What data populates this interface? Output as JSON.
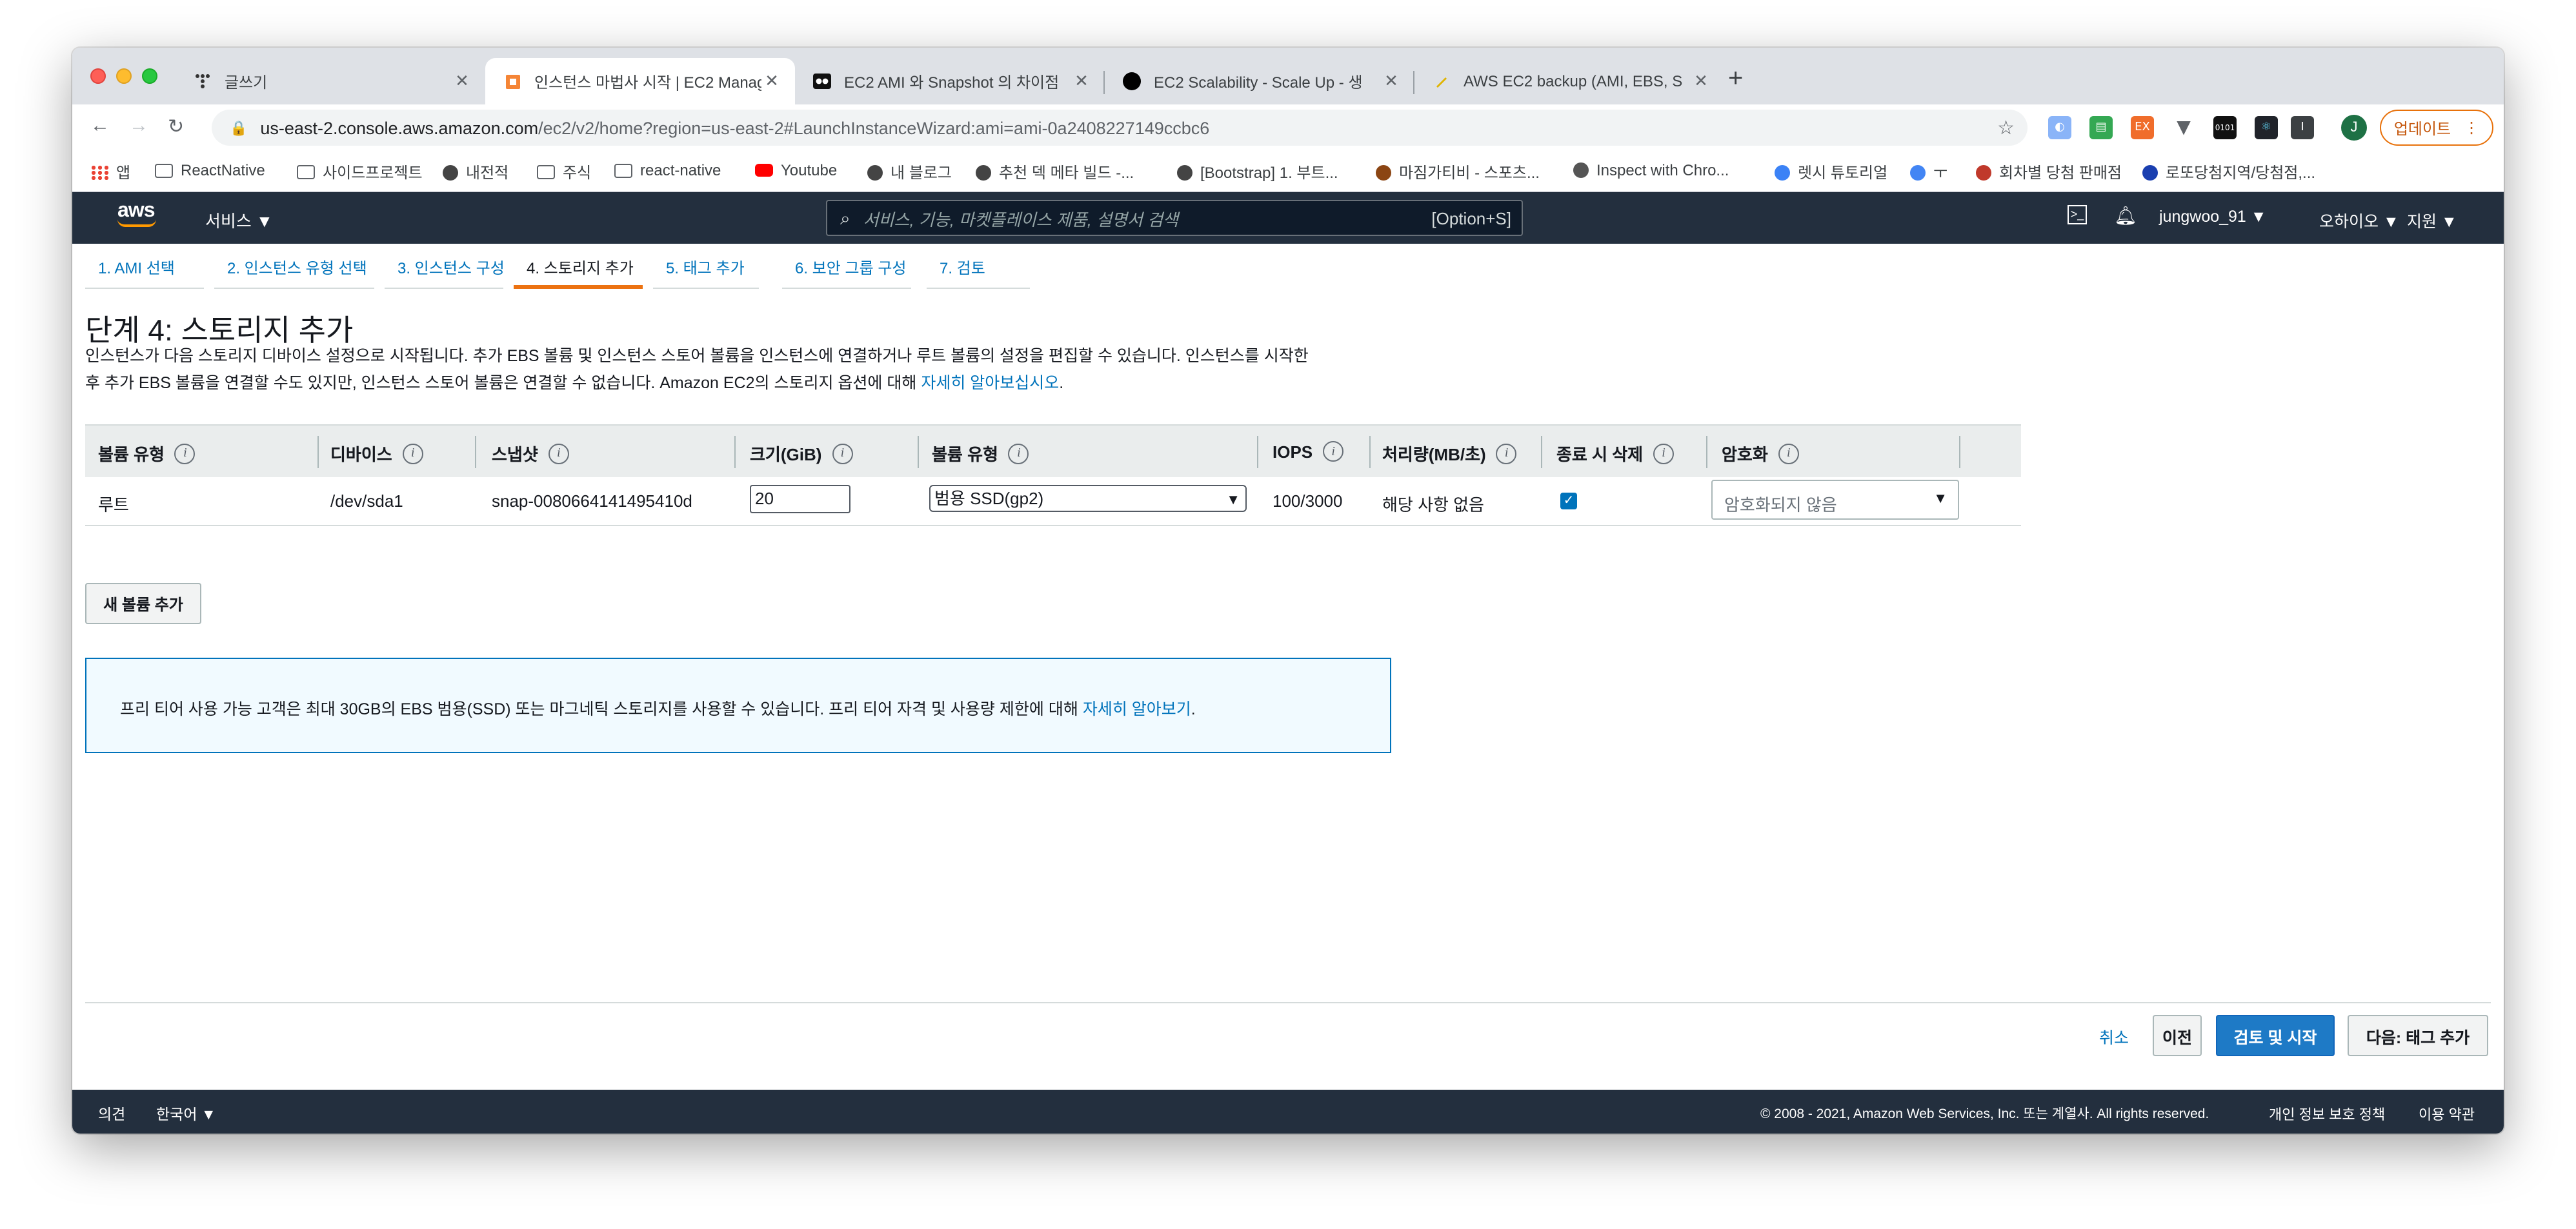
{
  "browser": {
    "tabs": [
      {
        "title": "글쓰기",
        "close": "✕"
      },
      {
        "title": "인스턴스 마법사 시작 | EC2 Manag",
        "close": "✕"
      },
      {
        "title": "EC2 AMI 와 Snapshot 의 차이점",
        "close": "✕"
      },
      {
        "title": "EC2 Scalability - Scale Up - 생",
        "close": "✕"
      },
      {
        "title": "AWS EC2 backup (AMI, EBS, S",
        "close": "✕"
      }
    ],
    "new_tab": "+",
    "url_host": "us-east-2.console.aws.amazon.com",
    "url_path": "/ec2/v2/home?region=us-east-2#LaunchInstanceWizard:ami=ami-0a2408227149ccbc6",
    "profile_initial": "J",
    "update_label": "업데이트",
    "bookmarks": [
      {
        "label": "앱",
        "icon": "apps-grid-icon"
      },
      {
        "label": "ReactNative",
        "icon": "folder-icon"
      },
      {
        "label": "사이드프로젝트",
        "icon": "folder-icon"
      },
      {
        "label": "내전적",
        "icon": "site-icon"
      },
      {
        "label": "주식",
        "icon": "folder-icon"
      },
      {
        "label": "react-native",
        "icon": "folder-icon"
      },
      {
        "label": "Youtube",
        "icon": "youtube-icon"
      },
      {
        "label": "내 블로그",
        "icon": "site-icon"
      },
      {
        "label": "추천 덱 메타 빌드 -...",
        "icon": "site-icon"
      },
      {
        "label": "[Bootstrap] 1. 부트...",
        "icon": "site-icon"
      },
      {
        "label": "마짐가티비 - 스포츠...",
        "icon": "site-icon"
      },
      {
        "label": "Inspect with Chro...",
        "icon": "site-icon"
      },
      {
        "label": "렛시 튜토리얼",
        "icon": "site-icon"
      },
      {
        "label": "회차별 당첨 판매점",
        "icon": "site-icon"
      },
      {
        "label": "로또당첨지역/당첨점,...",
        "icon": "site-icon"
      }
    ]
  },
  "aws": {
    "logo": "aws",
    "services": "서비스 ▼",
    "search_placeholder": "서비스, 기능, 마켓플레이스 제품, 설명서 검색",
    "search_shortcut": "[Option+S]",
    "user": "jungwoo_91 ▼",
    "region": "오하이오 ▼",
    "support": "지원 ▼"
  },
  "wizard": {
    "steps": [
      "1. AMI 선택",
      "2. 인스턴스 유형 선택",
      "3. 인스턴스 구성",
      "4. 스토리지 추가",
      "5. 태그 추가",
      "6. 보안 그룹 구성",
      "7. 검토"
    ],
    "current_step": 4,
    "title": "단계 4: 스토리지 추가",
    "desc_line1": "인스턴스가 다음 스토리지 디바이스 설정으로 시작됩니다. 추가 EBS 볼륨 및 인스턴스 스토어 볼륨을 인스턴스에 연결하거나 루트 볼륨의 설정을 편집할 수 있습니다. 인스턴스를 시작한",
    "desc_line2": "후 추가 EBS 볼륨을 연결할 수도 있지만, 인스턴스 스토어 볼륨은 연결할 수 없습니다. Amazon EC2의 스토리지 옵션에 대해",
    "desc_link": "자세히 알아보십시오",
    "desc_end": "."
  },
  "table": {
    "headers": [
      "볼륨 유형",
      "디바이스",
      "스냅샷",
      "크기(GiB)",
      "볼륨 유형",
      "IOPS",
      "처리량(MB/초)",
      "종료 시 삭제",
      "암호화"
    ],
    "row": {
      "volume_type": "루트",
      "device": "/dev/sda1",
      "snapshot": "snap-0080664141495410d",
      "size": "20",
      "ebs_type": "범용 SSD(gp2)",
      "iops": "100/3000",
      "throughput": "해당 사항 없음",
      "delete_on_termination": true,
      "encryption": "암호화되지 않음"
    }
  },
  "add_volume": "새 볼륨 추가",
  "notice": {
    "text": "프리 티어 사용 가능 고객은 최대 30GB의 EBS 범용(SSD) 또는 마그네틱 스토리지를 사용할 수 있습니다. 프리 티어 자격 및 사용량 제한에 대해",
    "link": "자세히 알아보기",
    "end": "."
  },
  "actions": {
    "cancel": "취소",
    "previous": "이전",
    "review_launch": "검토 및 시작",
    "next": "다음: 태그 추가"
  },
  "footer": {
    "feedback": "의견",
    "language": "한국어 ▼",
    "copyright": "© 2008 - 2021, Amazon Web Services, Inc. 또는 계열사. All rights reserved.",
    "privacy": "개인 정보 보호 정책",
    "terms": "이용 약관"
  }
}
